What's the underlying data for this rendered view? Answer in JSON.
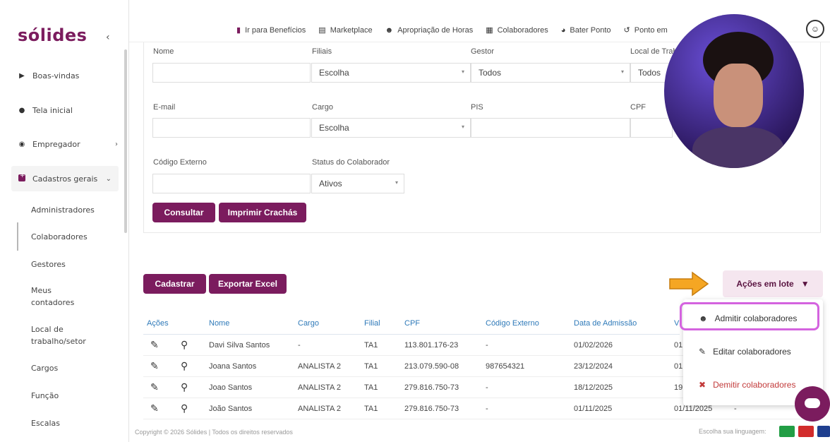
{
  "brand": "sólides",
  "sidebar": {
    "items": [
      {
        "label": "Boas-vindas",
        "icon": "play-icon"
      },
      {
        "label": "Tela inicial",
        "icon": "info-icon"
      },
      {
        "label": "Empregador",
        "icon": "user-circle-icon"
      },
      {
        "label": "Cadastros gerais",
        "icon": "plus-square-icon"
      }
    ],
    "sub": [
      "Administradores",
      "Colaboradores",
      "Gestores",
      "Meus contadores",
      "Local de trabalho/setor",
      "Cargos",
      "Função",
      "Escalas"
    ]
  },
  "topnav": [
    "Ir para Benefícios",
    "Marketplace",
    "Apropriação de Horas",
    "Colaboradores",
    "Bater Ponto",
    "Ponto em"
  ],
  "filters": {
    "nome_label": "Nome",
    "filiais_label": "Filiais",
    "filiais_value": "Escolha",
    "gestor_label": "Gestor",
    "gestor_value": "Todos",
    "local_label": "Local de Trab",
    "local_value": "Todos",
    "email_label": "E-mail",
    "cargo_label": "Cargo",
    "cargo_value": "Escolha",
    "pis_label": "PIS",
    "cpf_label": "CPF",
    "codigo_label": "Código Externo",
    "status_label": "Status do Colaborador",
    "status_value": "Ativos"
  },
  "buttons": {
    "consultar": "Consultar",
    "crachas": "Imprimir Crachás",
    "cadastrar": "Cadastrar",
    "exportar": "Exportar Excel",
    "lote": "Ações em lote"
  },
  "table": {
    "headers": [
      "Ações",
      "Nome",
      "Cargo",
      "Filial",
      "CPF",
      "Código Externo",
      "Data de Admissão",
      "V"
    ],
    "rows": [
      [
        "Davi Silva Santos",
        "-",
        "TA1",
        "113.801.176-23",
        "-",
        "01/02/2026",
        "01"
      ],
      [
        "Joana Santos",
        "ANALISTA 2",
        "TA1",
        "213.079.590-08",
        "987654321",
        "23/12/2024",
        "01"
      ],
      [
        "Joao Santos",
        "ANALISTA 2",
        "TA1",
        "279.816.750-73",
        "-",
        "18/12/2025",
        "19"
      ],
      [
        "João Santos",
        "ANALISTA 2",
        "TA1",
        "279.816.750-73",
        "-",
        "01/11/2025",
        "01/11/2025"
      ]
    ],
    "last_extra": "-"
  },
  "menu": [
    "Admitir colaboradores",
    "Editar colaboradores",
    "Demitir colaboradores"
  ],
  "footer": "Copyright © 2026 Sólides | Todos os direitos reservados",
  "lang_label": "Escolha sua linguagem:",
  "colors": {
    "brand": "#7b1c5e",
    "link": "#2f7ab9",
    "highlight": "#d463df",
    "arrow": "#f5a623"
  }
}
